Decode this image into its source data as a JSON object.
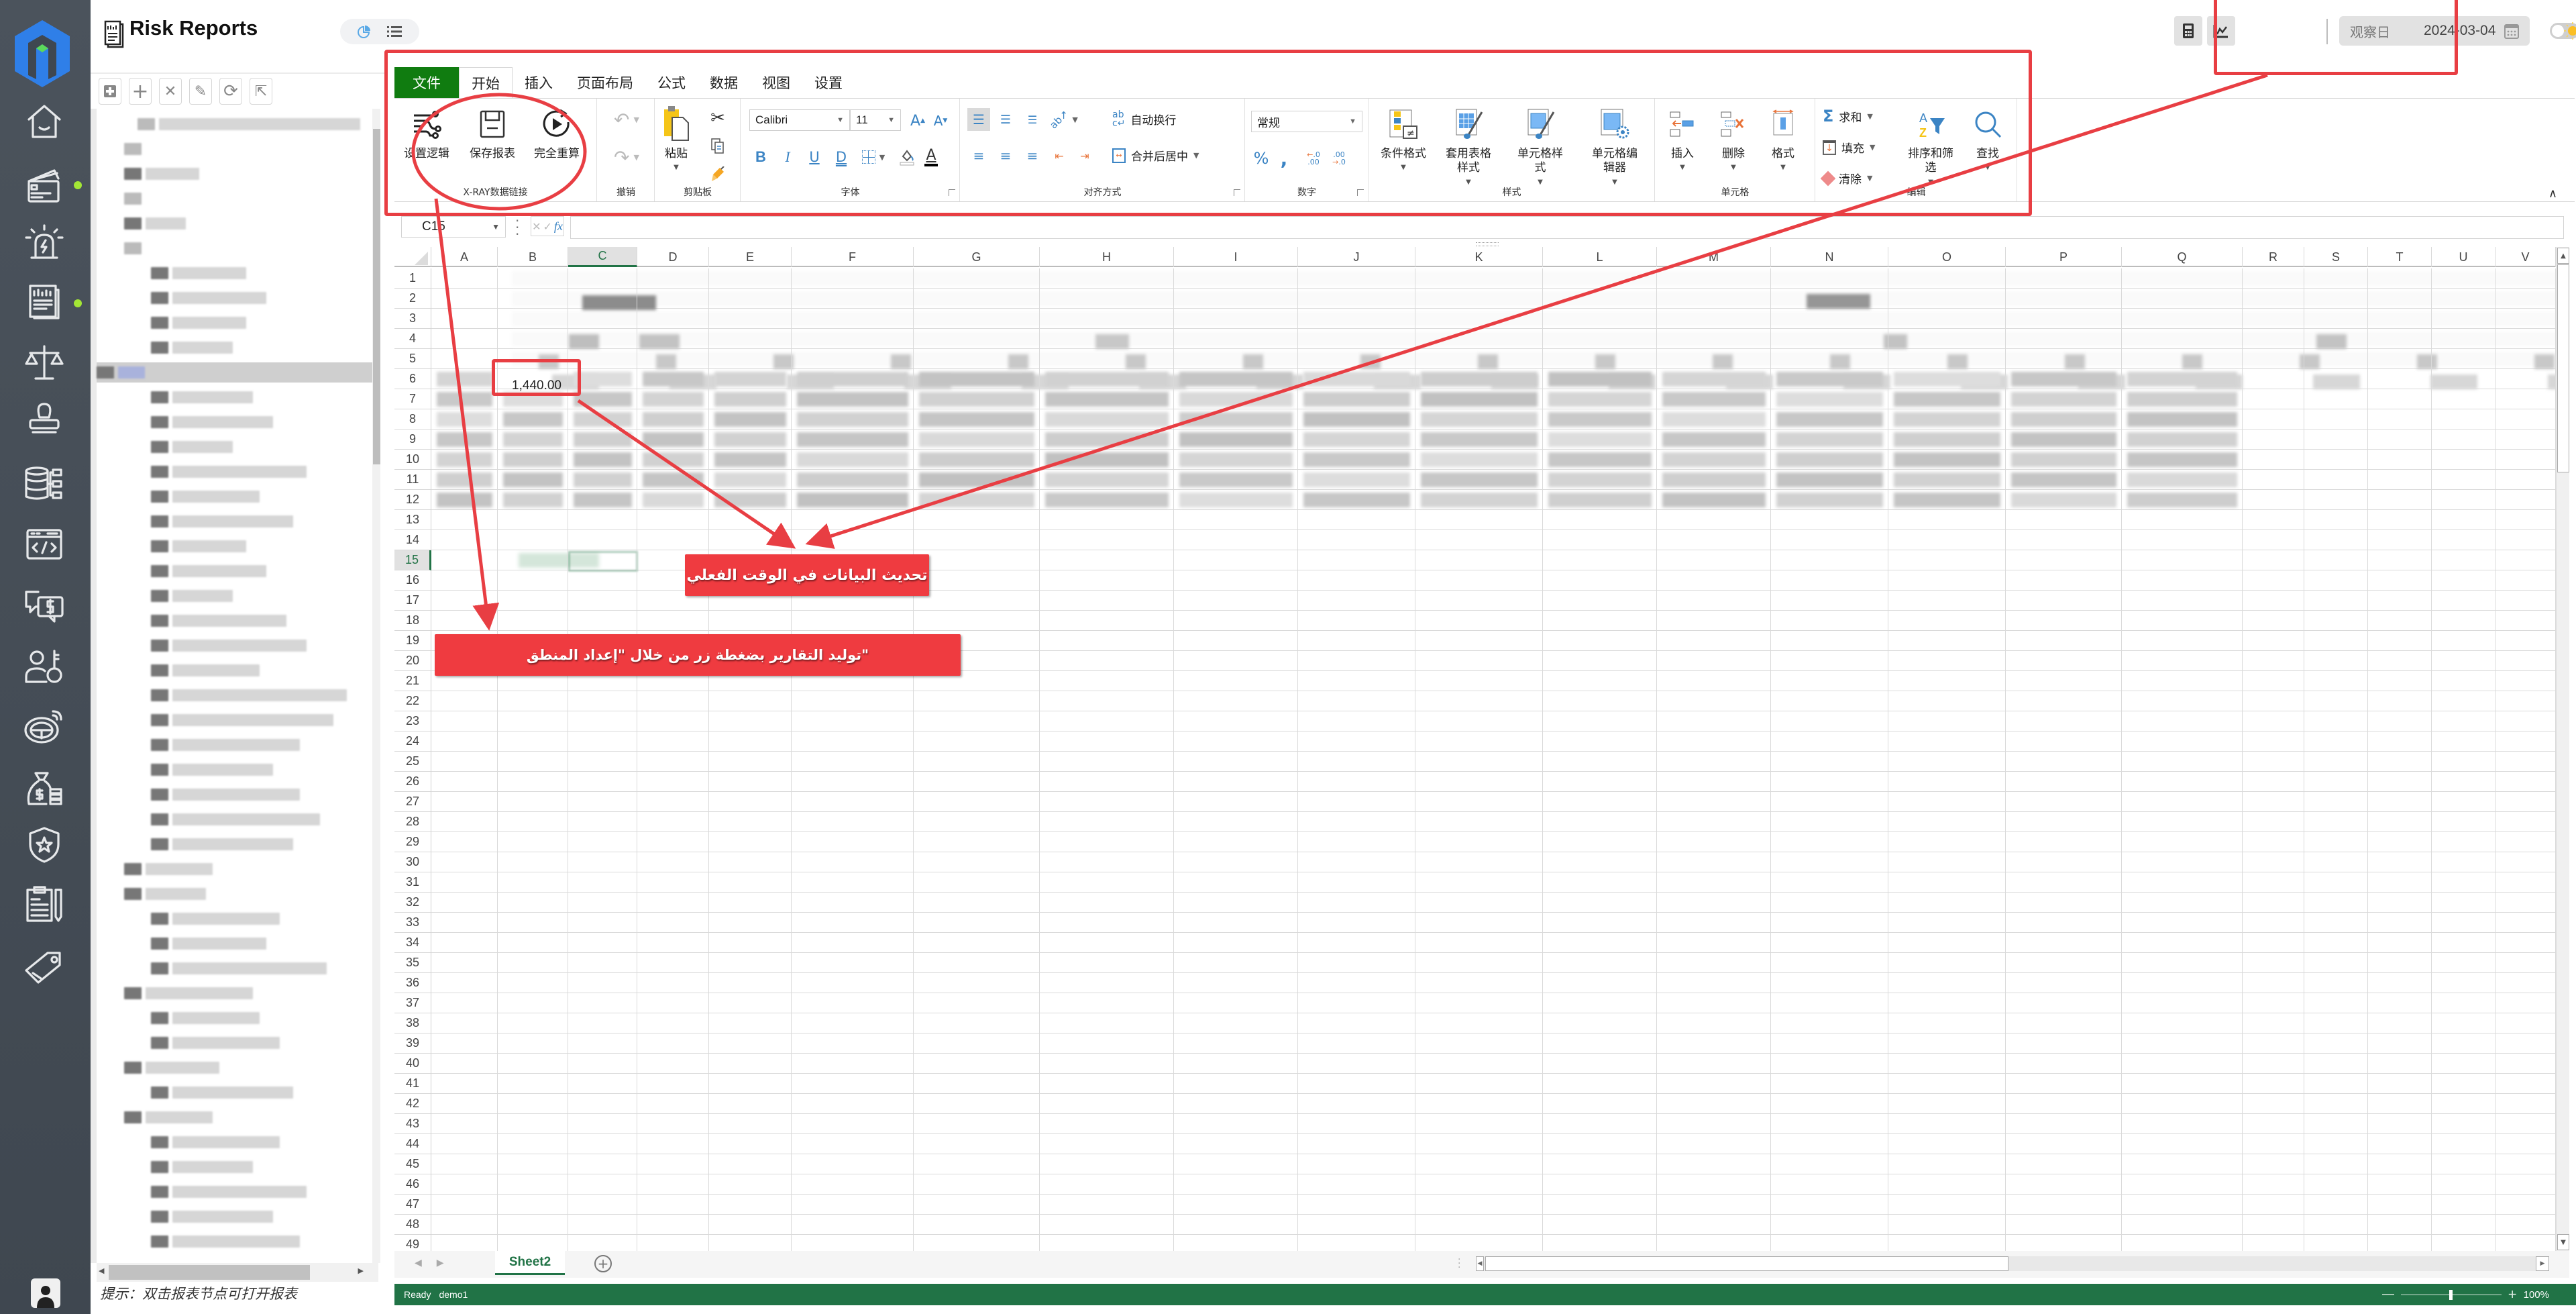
{
  "app": {
    "title": "Risk Reports",
    "view_toggle": [
      {
        "icon": "pie-chart-icon",
        "label": "chart-view"
      },
      {
        "icon": "list-icon",
        "label": "list-view"
      }
    ]
  },
  "nav_rail": {
    "items": [
      {
        "icon": "home-icon",
        "badge": false
      },
      {
        "icon": "credit-card-icon",
        "badge": true
      },
      {
        "icon": "alarm-siren-icon",
        "badge": false
      },
      {
        "icon": "report-doc-icon",
        "badge": true
      },
      {
        "icon": "balance-scale-icon",
        "badge": false
      },
      {
        "icon": "stamp-icon",
        "badge": false
      },
      {
        "icon": "database-network-icon",
        "badge": false
      },
      {
        "icon": "code-window-icon",
        "badge": false
      },
      {
        "icon": "chat-dollar-icon",
        "badge": false
      },
      {
        "icon": "user-key-icon",
        "badge": false
      },
      {
        "icon": "steering-wheel-icon",
        "badge": false
      },
      {
        "icon": "money-bag-icon",
        "badge": false
      },
      {
        "icon": "shield-star-icon",
        "badge": false
      },
      {
        "icon": "clipboard-pen-icon",
        "badge": false
      },
      {
        "icon": "tag-icon",
        "badge": false
      }
    ],
    "badge_color": "#a3e635"
  },
  "header_right": {
    "calculator_icon": "calculator-icon",
    "chart_icon": "line-chart-icon",
    "observation_date_label": "观察日",
    "observation_date_value": "2024-03-04",
    "calendar_icon": "calendar-icon",
    "theme_toggle": "light",
    "language": "en-US"
  },
  "tree_panel": {
    "toolbar": [
      {
        "name": "add-folder",
        "glyph": "⊞"
      },
      {
        "name": "add",
        "glyph": "+"
      },
      {
        "name": "delete",
        "glyph": "✕"
      },
      {
        "name": "edit",
        "glyph": "✎"
      },
      {
        "name": "refresh",
        "glyph": "⟳"
      },
      {
        "name": "share",
        "glyph": "⇱"
      }
    ],
    "hint": "提示：双击报表节点可打开报表",
    "content_obscured": true
  },
  "ribbon": {
    "tabs": [
      {
        "label": "文件",
        "type": "file"
      },
      {
        "label": "开始",
        "active": true
      },
      {
        "label": "插入"
      },
      {
        "label": "页面布局"
      },
      {
        "label": "公式"
      },
      {
        "label": "数据"
      },
      {
        "label": "视图"
      },
      {
        "label": "设置"
      }
    ],
    "groups": {
      "xray": {
        "label": "X-RAY数据链接",
        "buttons": [
          "设置逻辑",
          "保存报表",
          "完全重算"
        ]
      },
      "undo": {
        "label": "撤销"
      },
      "clipboard": {
        "label": "剪贴板",
        "paste": "粘贴"
      },
      "font": {
        "label": "字体",
        "font_name": "Calibri",
        "font_size": "11",
        "bold": "B",
        "italic": "I",
        "underline": "U",
        "double_underline": "D",
        "grow": "A",
        "shrink": "A",
        "font_color": "A"
      },
      "alignment": {
        "label": "对齐方式",
        "wrap_text": "自动换行",
        "merge_center": "合并后居中"
      },
      "number": {
        "label": "数字",
        "format": "常规",
        "percent": "%",
        "comma": ","
      },
      "styles": {
        "label": "样式",
        "conditional_format": "条件格式",
        "table_style": "套用表格样式",
        "cell_style": "单元格样式",
        "cell_editor": "单元格编辑器"
      },
      "cells": {
        "label": "单元格",
        "insert": "插入",
        "delete": "删除",
        "format": "格式"
      },
      "editing": {
        "label": "编辑",
        "sum": "求和",
        "fill": "填充",
        "clear": "清除",
        "sort_filter": "排序和筛选",
        "find": "查找"
      }
    }
  },
  "formula_bar": {
    "name_box": "C15",
    "cancel": "✕",
    "confirm": "✓",
    "fx": "fx",
    "formula": ""
  },
  "sheet": {
    "columns": [
      "A",
      "B",
      "C",
      "D",
      "E",
      "F",
      "G",
      "H",
      "I",
      "J",
      "K",
      "L",
      "M",
      "N",
      "O",
      "P",
      "Q",
      "R",
      "S",
      "T",
      "U",
      "V"
    ],
    "active_column": "C",
    "rows": [
      1,
      2,
      3,
      4,
      5,
      6,
      7,
      8,
      9,
      10,
      11,
      12,
      13,
      14,
      15,
      16,
      17,
      18,
      19,
      20,
      21,
      22,
      23,
      24,
      25,
      26,
      27,
      28,
      29,
      30,
      31,
      32,
      33,
      34,
      35,
      36,
      37,
      38,
      39,
      40,
      41,
      42,
      43,
      44,
      45,
      46,
      47,
      48,
      49
    ],
    "active_row": 15,
    "visible_cell_b6": "1,440.00",
    "data_obscured_rows": "1-12"
  },
  "sheet_tabs": {
    "tabs": [
      "Sheet2"
    ],
    "active": "Sheet2",
    "add_icon": "plus-circle-icon"
  },
  "status_bar": {
    "state": "Ready",
    "user": "demo1",
    "zoom": "100%",
    "zoom_level": 1.0
  },
  "annotations": {
    "color": "#ef3b40",
    "realtime_label": "تحديث البيانات في الوقت الفعلي",
    "one_click_label": "\"توليد التقارير بضغطة زر من خلال \"إعداد المنطق"
  }
}
